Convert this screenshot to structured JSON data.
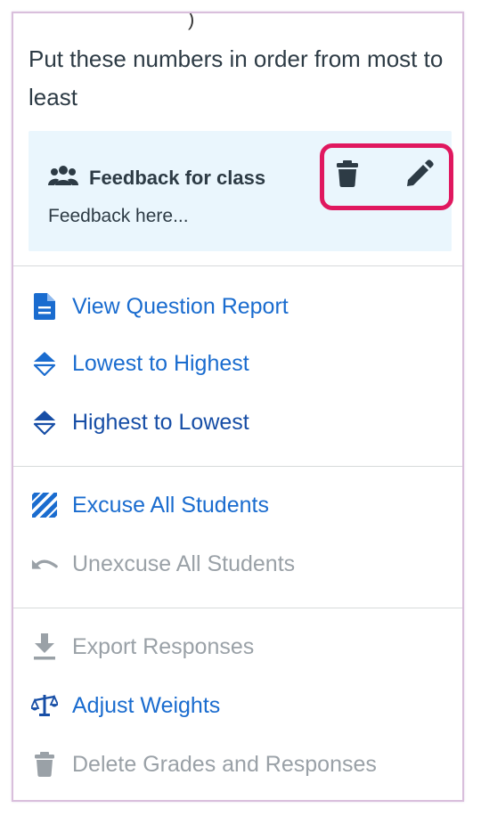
{
  "question": {
    "text": "Put these numbers in order from most to least"
  },
  "feedback": {
    "title": "Feedback for class",
    "body": "Feedback here...",
    "icons": {
      "group": "group-icon",
      "delete": "trash-icon",
      "edit": "pencil-icon"
    },
    "highlight_color": "#e0185f"
  },
  "menu": {
    "view_report": "View Question Report",
    "lowest_to_highest": "Lowest to Highest",
    "highest_to_lowest": "Highest to Lowest",
    "excuse_all": "Excuse All Students",
    "unexcuse_all": "Unexcuse All Students",
    "export_responses": "Export Responses",
    "adjust_weights": "Adjust Weights",
    "delete_grades": "Delete Grades and Responses"
  },
  "colors": {
    "link": "#1a6ccf",
    "disabled": "#9aa1a7",
    "feedback_bg": "#eaf6fd"
  }
}
